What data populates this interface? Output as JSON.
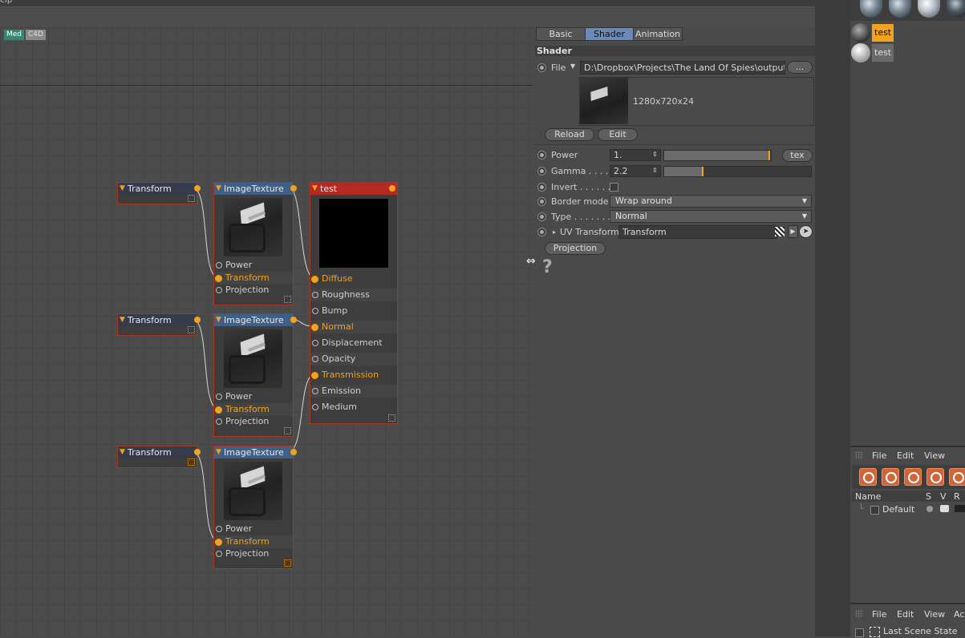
{
  "menubar": {
    "partial_label": "elp"
  },
  "editor": {
    "tags": {
      "med": "Med",
      "c4d": "C4D"
    },
    "transform_nodes": [
      {
        "label": "Transform"
      },
      {
        "label": "Transform"
      },
      {
        "label": "Transform"
      }
    ],
    "image_texture_nodes": [
      {
        "label": "ImageTexture",
        "pins": [
          "Power",
          "Transform",
          "Projection"
        ]
      },
      {
        "label": "ImageTexture",
        "pins": [
          "Power",
          "Transform",
          "Projection"
        ]
      },
      {
        "label": "ImageTexture",
        "pins": [
          "Power",
          "Transform",
          "Projection"
        ]
      }
    ],
    "material_node": {
      "label": "test",
      "pins": [
        "Diffuse",
        "Roughness",
        "Bump",
        "Normal",
        "Displacement",
        "Opacity",
        "Transmission",
        "Emission",
        "Medium"
      ]
    }
  },
  "attributes": {
    "tabs": {
      "basic": "Basic",
      "shader": "Shader",
      "animation": "Animation"
    },
    "section": "Shader",
    "file_label": "File",
    "file_path": "D:\\Dropbox\\Projects\\The Land Of Spies\\output\\",
    "browse_label": "...",
    "image_info": "1280x720x24",
    "reload_label": "Reload",
    "edit_label": "Edit",
    "power_label": "Power",
    "power_value": "1.",
    "tex_label": "tex",
    "gamma_label": "Gamma . . . . .",
    "gamma_value": "2.2",
    "invert_label": "Invert . . . . . .",
    "border_label": "Border mode",
    "border_value": "Wrap around",
    "type_label": "Type . . . . . . .",
    "type_value": "Normal",
    "uv_label": "UV Transform",
    "uv_value": "Transform",
    "projection_label": "Projection",
    "help_glyph": "?"
  },
  "materials": [
    {
      "name": "test",
      "selected": true
    },
    {
      "name": "test",
      "selected": false
    }
  ],
  "layers": {
    "menu": {
      "file": "File",
      "edit": "Edit",
      "view": "View"
    },
    "columns": {
      "name": "Name",
      "s": "S",
      "v": "V",
      "r": "R"
    },
    "rows": [
      {
        "name": "Default"
      }
    ]
  },
  "scene": {
    "menu": {
      "file": "File",
      "edit": "Edit",
      "view": "View",
      "more": "Ac"
    },
    "item": "Last Scene State"
  },
  "colors": {
    "accent": "#f2a21e",
    "shader_tab": "#6a8ab8",
    "node_blue": "#3f5f86",
    "node_red": "#b42a22"
  }
}
